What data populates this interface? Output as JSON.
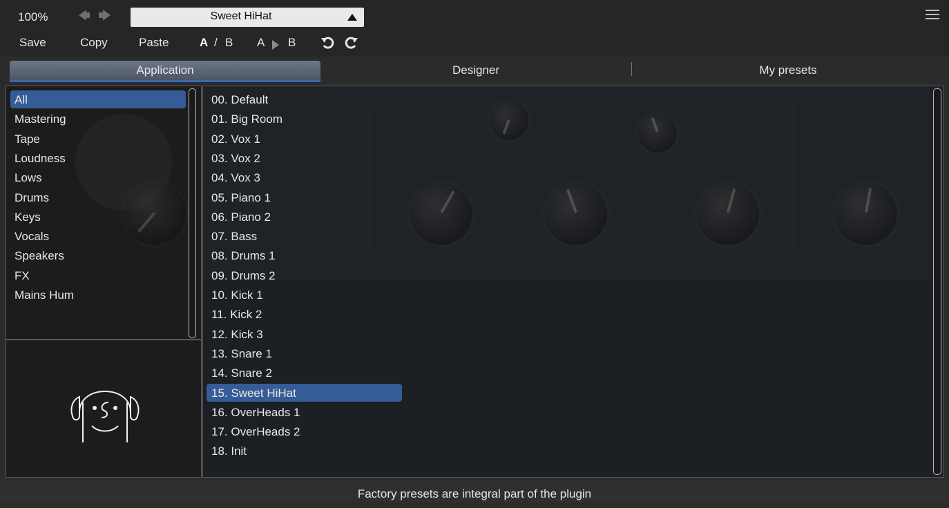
{
  "toolbar": {
    "zoom": "100%",
    "preset_name": "Sweet HiHat",
    "save": "Save",
    "copy": "Copy",
    "paste": "Paste",
    "ab_a": "A",
    "ab_sep": "/",
    "ab_b": "B",
    "copy_a": "A",
    "copy_b": "B",
    "icons": [
      "prev-arrow-icon",
      "next-arrow-icon",
      "dropdown-triangle-icon",
      "undo-icon",
      "redo-icon",
      "hamburger-menu-icon"
    ]
  },
  "tabs": [
    "Application",
    "Designer",
    "My presets"
  ],
  "categories": [
    "All",
    "Mastering",
    "Tape",
    "Loudness",
    "Lows",
    "Drums",
    "Keys",
    "Vocals",
    "Speakers",
    "FX",
    "Mains Hum"
  ],
  "selected_category": "All",
  "presets": [
    "00. Default",
    "01. Big Room",
    "02. Vox 1",
    "03. Vox 2",
    "04. Vox 3",
    "05. Piano 1",
    "06. Piano 2",
    "07. Bass",
    "08. Drums 1",
    "09. Drums 2",
    "10. Kick 1",
    "11. Kick 2",
    "12. Kick 3",
    "13. Snare 1",
    "14. Snare 2",
    "15. Sweet HiHat",
    "16. OverHeads 1",
    "17. OverHeads 2",
    "18. Init"
  ],
  "selected_preset": "15. Sweet HiHat",
  "status": "Factory presets are integral part of the plugin",
  "colors": {
    "selection": "#365c97",
    "tab_underline": "#3a6ab0",
    "background": "#1c1f24"
  }
}
